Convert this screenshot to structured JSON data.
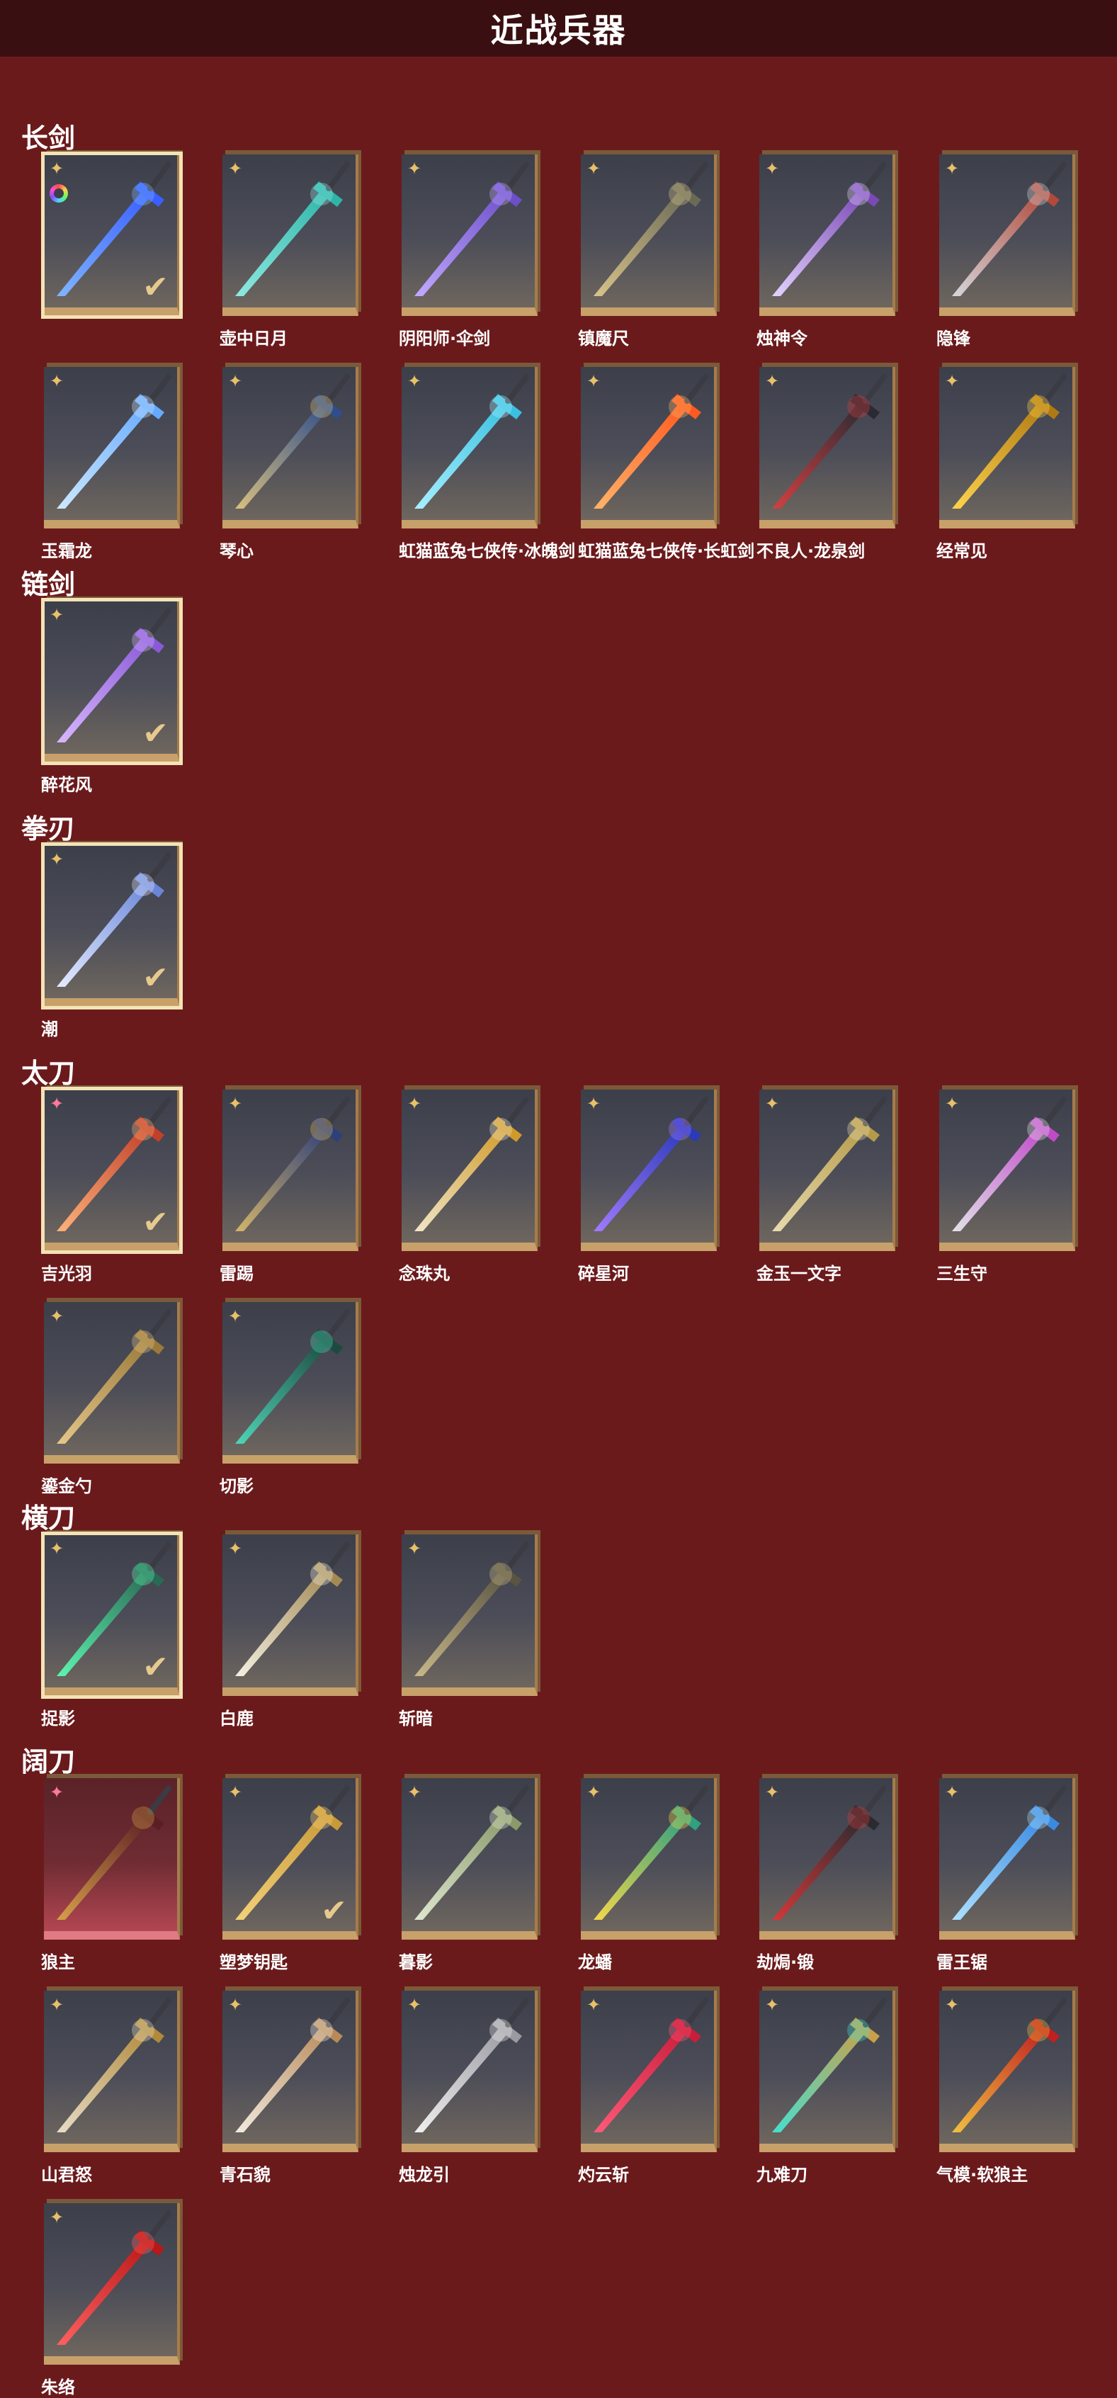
{
  "header": {
    "title": "近战兵器"
  },
  "sections": [
    {
      "title": "长剑",
      "items": [
        {
          "name": "",
          "selected": true,
          "check": true,
          "swatch": true,
          "badge": "gold",
          "colors": [
            "#7fb6ff",
            "#3a5eff"
          ]
        },
        {
          "name": "壶中日月",
          "badge": "gold",
          "colors": [
            "#8fe9e1",
            "#2fb5a8"
          ]
        },
        {
          "name": "阴阳师·伞剑",
          "badge": "gold",
          "colors": [
            "#c2a9ff",
            "#6d50c8"
          ]
        },
        {
          "name": "镇魔尺",
          "badge": "gold",
          "colors": [
            "#d8c48a",
            "#6b6a57"
          ]
        },
        {
          "name": "烛神令",
          "badge": "gold",
          "colors": [
            "#e3d3ff",
            "#7a49b5"
          ]
        },
        {
          "name": "隐锋",
          "badge": "gold",
          "colors": [
            "#d5d7db",
            "#b04a3b"
          ]
        },
        {
          "name": "玉霜龙",
          "badge": "gold",
          "colors": [
            "#cfe9ff",
            "#66aaff"
          ]
        },
        {
          "name": "琴心",
          "badge": "gold",
          "colors": [
            "#d9c080",
            "#2f4e8a"
          ]
        },
        {
          "name": "虹猫蓝兔七侠传·冰魄剑",
          "badge": "gold",
          "colors": [
            "#a8f0ff",
            "#3ac0e0"
          ]
        },
        {
          "name": "虹猫蓝兔七侠传·长虹剑",
          "badge": "gold",
          "colors": [
            "#ffb46b",
            "#ff5a1f"
          ]
        },
        {
          "name": "不良人·龙泉剑",
          "badge": "gold",
          "colors": [
            "#d34040",
            "#2a2a33"
          ]
        },
        {
          "name": "经常见",
          "badge": "gold",
          "colors": [
            "#ffd34d",
            "#b07a13"
          ]
        }
      ]
    },
    {
      "title": "链剑",
      "items": [
        {
          "name": "醉花风",
          "selected": true,
          "check": true,
          "badge": "gold",
          "colors": [
            "#d8b8ff",
            "#8a5ad6"
          ]
        }
      ]
    },
    {
      "title": "拳刃",
      "items": [
        {
          "name": "潮",
          "selected": true,
          "check": true,
          "badge": "gold",
          "colors": [
            "#e4ecff",
            "#6b86d9"
          ]
        }
      ]
    },
    {
      "title": "太刀",
      "items": [
        {
          "name": "吉光羽",
          "selected": true,
          "check": true,
          "badge": "pink",
          "colors": [
            "#ffb27a",
            "#c0402a"
          ]
        },
        {
          "name": "雷踢",
          "badge": "gold",
          "colors": [
            "#d4b56a",
            "#2e3f7a"
          ]
        },
        {
          "name": "念珠丸",
          "badge": "gold",
          "colors": [
            "#f0e6c8",
            "#d09a2a"
          ]
        },
        {
          "name": "碎星河",
          "badge": "gold",
          "colors": [
            "#a27bff",
            "#2a3ab8"
          ]
        },
        {
          "name": "金玉一文字",
          "badge": "gold",
          "colors": [
            "#e8dcae",
            "#b59a4a"
          ]
        },
        {
          "name": "三生守",
          "badge": "gold",
          "colors": [
            "#e2e2e8",
            "#c04ac8"
          ]
        },
        {
          "name": "鎏金勺",
          "badge": "gold",
          "colors": [
            "#e5c78a",
            "#9a7a3a"
          ]
        },
        {
          "name": "切影",
          "badge": "gold",
          "colors": [
            "#4fd6b8",
            "#1c4a3f"
          ]
        }
      ]
    },
    {
      "title": "横刀",
      "items": [
        {
          "name": "捉影",
          "selected": true,
          "check": true,
          "badge": "gold",
          "colors": [
            "#5ef5b0",
            "#2a6a55"
          ]
        },
        {
          "name": "白鹿",
          "badge": "gold",
          "colors": [
            "#f4f0e2",
            "#a38a55"
          ]
        },
        {
          "name": "斩暗",
          "badge": "gold",
          "colors": [
            "#c9b98a",
            "#5a5442"
          ]
        }
      ]
    },
    {
      "title": "阔刀",
      "items": [
        {
          "name": "狼主",
          "red": true,
          "badge": "pink",
          "colors": [
            "#d7a04a",
            "#5a1f24"
          ]
        },
        {
          "name": "塑梦钥匙",
          "check": true,
          "badge": "gold",
          "colors": [
            "#f5d27a",
            "#c89a3a"
          ]
        },
        {
          "name": "暮影",
          "badge": "gold",
          "colors": [
            "#dfe8d0",
            "#8a9a6a"
          ]
        },
        {
          "name": "龙蟠",
          "badge": "gold",
          "colors": [
            "#f5d84a",
            "#2fa080"
          ]
        },
        {
          "name": "劫焗·锻",
          "badge": "gold",
          "colors": [
            "#d43838",
            "#2a2a30"
          ]
        },
        {
          "name": "雷王锯",
          "badge": "gold",
          "colors": [
            "#aee2ff",
            "#3a8ae0"
          ]
        },
        {
          "name": "山君怒",
          "badge": "gold",
          "colors": [
            "#e8ddc8",
            "#b08a3a"
          ]
        },
        {
          "name": "青石貌",
          "badge": "gold",
          "colors": [
            "#f2ebe0",
            "#b88a5a"
          ]
        },
        {
          "name": "烛龙引",
          "badge": "gold",
          "colors": [
            "#f0f0f0",
            "#9a9aa2"
          ]
        },
        {
          "name": "灼云斩",
          "badge": "gold",
          "colors": [
            "#ff5a7a",
            "#c81e3a"
          ]
        },
        {
          "name": "九难刀",
          "badge": "gold",
          "colors": [
            "#46e0d0",
            "#c8a04a"
          ]
        },
        {
          "name": "气模·软狼主",
          "badge": "gold",
          "colors": [
            "#f2c040",
            "#c02020"
          ]
        },
        {
          "name": "朱络",
          "badge": "gold",
          "colors": [
            "#ff6060",
            "#b81818"
          ]
        }
      ]
    }
  ],
  "icons": {
    "badge": "sparkle-icon",
    "check": "checkmark-icon",
    "swatch": "color-wheel-icon"
  }
}
